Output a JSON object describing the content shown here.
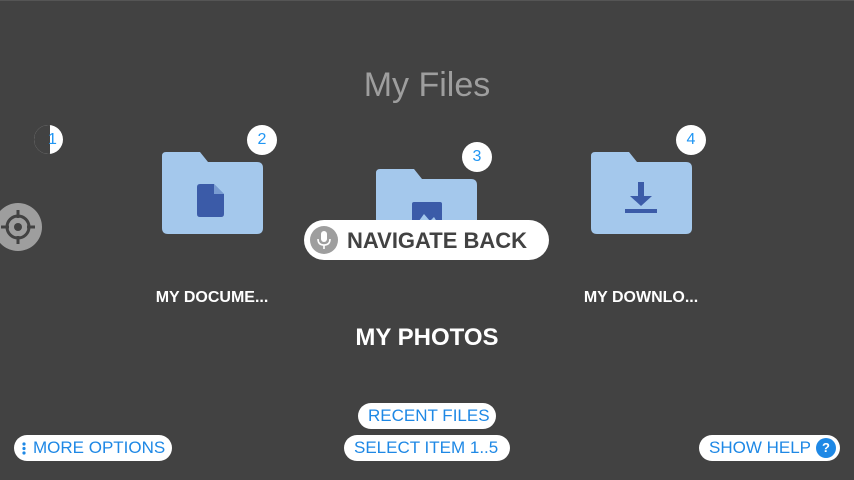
{
  "header": {
    "title": "My Files"
  },
  "edge_item": {
    "badge": "1"
  },
  "items": [
    {
      "badge": "2",
      "label": "MY DOCUME...",
      "icon": "document-icon"
    },
    {
      "badge": "3",
      "label": "MY PHOTOS",
      "icon": "image-icon"
    },
    {
      "badge": "4",
      "label": "MY DOWNLO...",
      "icon": "download-icon"
    }
  ],
  "voice_command": {
    "label": "NAVIGATE BACK",
    "icon": "microphone-icon"
  },
  "bottom_bar": {
    "more_options": "MORE OPTIONS",
    "recent_files": "RECENT FILES",
    "select_item": "SELECT ITEM 1..5",
    "show_help": "SHOW HELP",
    "help_glyph": "?"
  },
  "colors": {
    "background": "#424242",
    "folder": "#a4c8ec",
    "folder_icon": "#3b5ba8",
    "accent": "#1e88e5"
  }
}
